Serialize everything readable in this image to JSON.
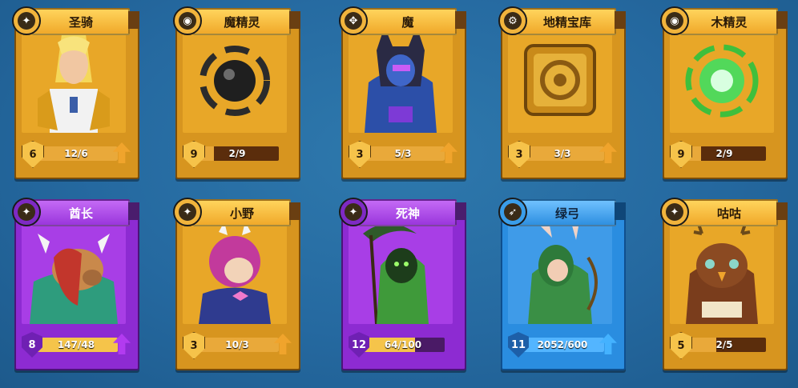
{
  "cards": [
    {
      "name": "圣骑",
      "level": "6",
      "progress": "12/6",
      "progress_fraction": 1.0,
      "theme": "gold",
      "badge_icon": "sparkle-icon"
    },
    {
      "name": "魔精灵",
      "level": "9",
      "progress": "2/9",
      "progress_fraction": 0.22,
      "theme": "gold",
      "badge_icon": "orb-icon"
    },
    {
      "name": "魔",
      "level": "3",
      "progress": "5/3",
      "progress_fraction": 1.0,
      "theme": "gold",
      "badge_icon": "crosshair-icon"
    },
    {
      "name": "地精宝库",
      "level": "3",
      "progress": "3/3",
      "progress_fraction": 1.0,
      "theme": "gold",
      "badge_icon": "gear-icon"
    },
    {
      "name": "木精灵",
      "level": "9",
      "progress": "2/9",
      "progress_fraction": 0.22,
      "theme": "gold",
      "badge_icon": "orb-icon"
    },
    {
      "name": "酋长",
      "level": "8",
      "progress": "147/48",
      "progress_fraction": 1.0,
      "theme": "purple",
      "badge_icon": "sparkle-icon"
    },
    {
      "name": "小野",
      "level": "3",
      "progress": "10/3",
      "progress_fraction": 1.0,
      "theme": "gold",
      "badge_icon": "sparkle-icon"
    },
    {
      "name": "死神",
      "level": "12",
      "progress": "64/100",
      "progress_fraction": 0.64,
      "theme": "purple",
      "badge_icon": "sparkle-icon"
    },
    {
      "name": "绿弓",
      "level": "11",
      "progress": "2052/600",
      "progress_fraction": 1.0,
      "theme": "blue",
      "badge_icon": "bow-icon"
    },
    {
      "name": "咕咕",
      "level": "5",
      "progress": "2/5",
      "progress_fraction": 0.4,
      "theme": "gold",
      "badge_icon": "sparkle-icon"
    }
  ]
}
